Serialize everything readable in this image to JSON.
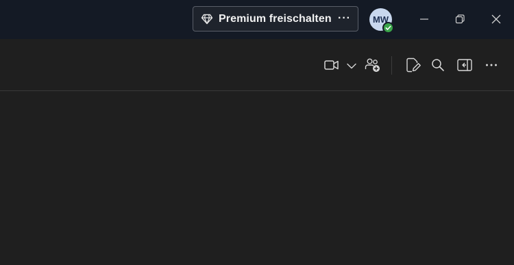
{
  "titlebar": {
    "premium_label": "Premium freischalten",
    "premium_more": "···",
    "premium_icon": "diamond-icon",
    "avatar_initials": "MW",
    "presence_status": "available",
    "colors": {
      "titlebar_bg": "#141a25",
      "avatar_bg": "#c8d7ee",
      "presence": "#3aa54a"
    }
  },
  "window_controls": [
    "minimize-icon",
    "restore-icon",
    "close-icon"
  ],
  "toolbar": {
    "icons": [
      "video-call-icon",
      "chevron-down-icon",
      "add-people-icon",
      "edit-icon",
      "search-icon",
      "side-panel-icon",
      "more-options-icon"
    ]
  }
}
